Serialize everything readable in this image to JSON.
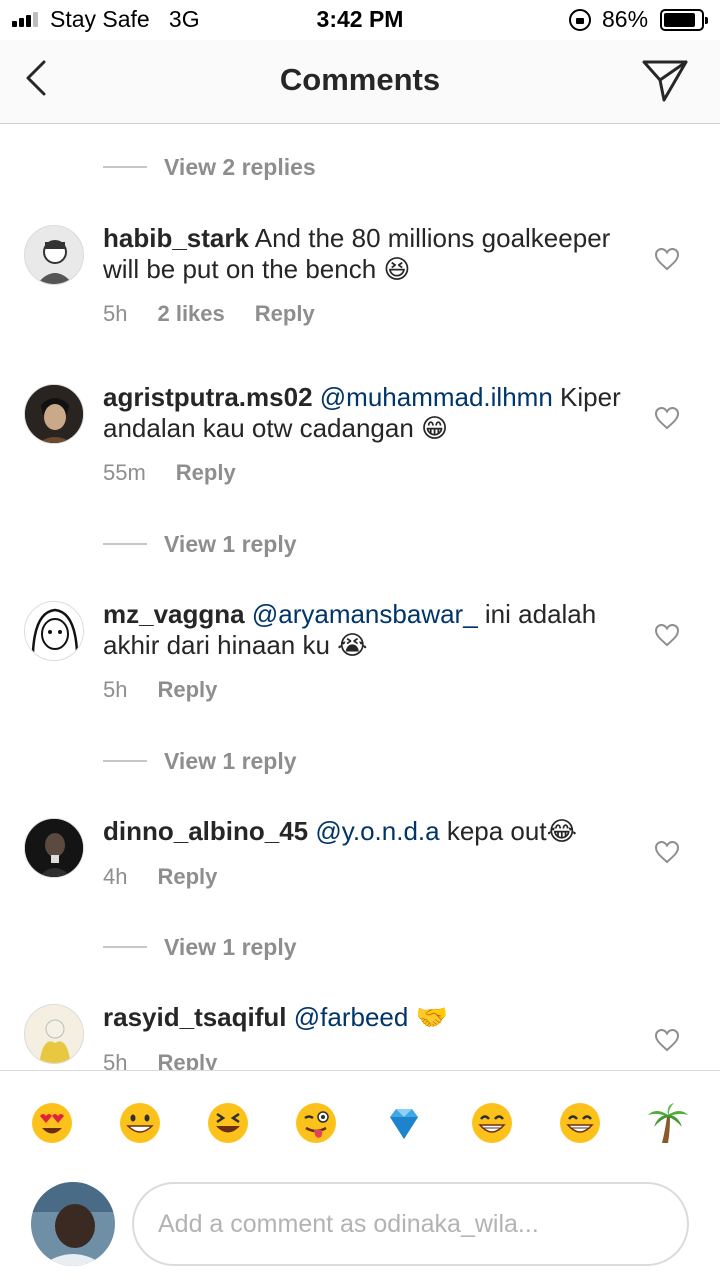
{
  "status": {
    "carrier": "Stay Safe",
    "network": "3G",
    "time": "3:42 PM",
    "battery": "86%",
    "battery_level": 0.86
  },
  "header": {
    "title": "Comments"
  },
  "threads": [
    {
      "view_replies": "View 2 replies"
    },
    {
      "user": "habib_stark",
      "mention": "",
      "text": "And the 80 millions goalkeeper will be put on the bench 😆",
      "time": "5h",
      "likes": "2 likes",
      "reply": "Reply"
    },
    {
      "user": "agristputra.ms02",
      "mention": "@muhammad.ilhmn",
      "text": "Kiper andalan kau otw cadangan 😁",
      "time": "55m",
      "likes": "",
      "reply": "Reply"
    },
    {
      "view_replies": "View 1 reply"
    },
    {
      "user": "mz_vaggna",
      "mention": "@aryamansbawar_",
      "text": "ini adalah akhir dari hinaan ku 😭",
      "time": "5h",
      "likes": "",
      "reply": "Reply"
    },
    {
      "view_replies": "View 1 reply"
    },
    {
      "user": "dinno_albino_45",
      "mention": "@y.o.n.d.a",
      "text": "kepa out😂",
      "time": "4h",
      "likes": "",
      "reply": "Reply"
    },
    {
      "view_replies": "View 1 reply"
    },
    {
      "user": "rasyid_tsaqiful",
      "mention": "@farbeed",
      "text": "🤝",
      "time": "5h",
      "likes": "",
      "reply": "Reply"
    }
  ],
  "quick_emojis": [
    "heart-eyes",
    "grinning",
    "squinting-laugh",
    "winking-tongue",
    "gem",
    "beaming-grin",
    "beaming-grin",
    "palm-tree"
  ],
  "composer": {
    "placeholder": "Add a comment as odinaka_wila..."
  }
}
